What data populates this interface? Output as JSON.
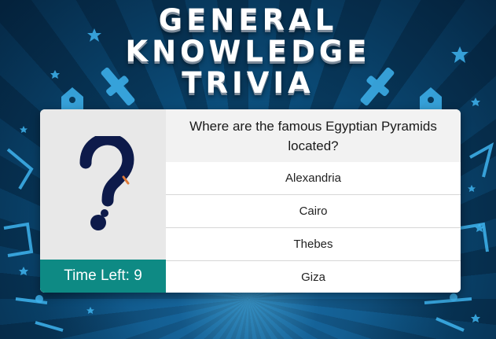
{
  "game": {
    "title_lines": [
      "GENERAL",
      "KNOWLEDGE",
      "TRIVIA"
    ],
    "question": "Where are the famous Egyptian Pyramids located?",
    "answers": [
      "Alexandria",
      "Cairo",
      "Thebes",
      "Giza"
    ],
    "timer_label": "Time Left: 9",
    "question_mark_icon": "question-mark-icon"
  },
  "colors": {
    "timer_bg": "#0e8a84",
    "question_mark": "#0d1a4a",
    "background": "#0a3a5c",
    "deco": "#3fb4ef"
  }
}
